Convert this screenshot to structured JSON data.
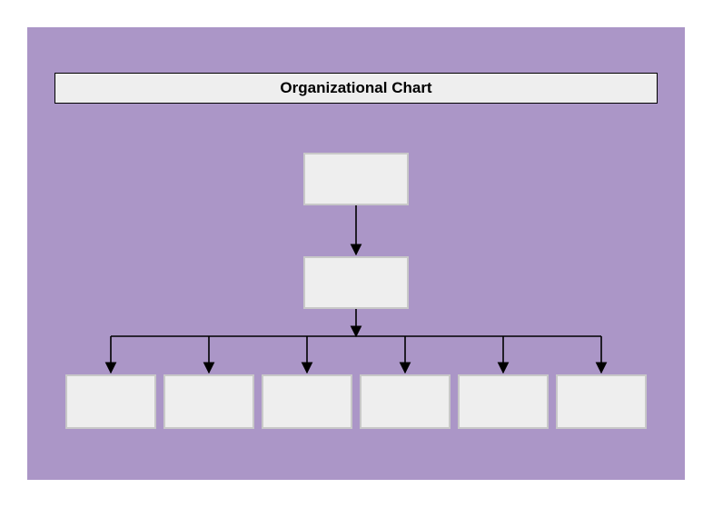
{
  "title": "Organizational Chart",
  "colors": {
    "canvas_bg": "#ab96c7",
    "node_fill": "#eeeeee",
    "node_border": "#c8c8c8",
    "title_fill": "#eeeeee",
    "title_border": "#000000",
    "connector": "#000000"
  },
  "nodes": {
    "root": {
      "label": ""
    },
    "mid": {
      "label": ""
    },
    "leaf1": {
      "label": ""
    },
    "leaf2": {
      "label": ""
    },
    "leaf3": {
      "label": ""
    },
    "leaf4": {
      "label": ""
    },
    "leaf5": {
      "label": ""
    },
    "leaf6": {
      "label": ""
    }
  },
  "chart_data": {
    "type": "org-chart",
    "title": "Organizational Chart",
    "root": {
      "id": "root",
      "label": "",
      "children": [
        {
          "id": "mid",
          "label": "",
          "children": [
            {
              "id": "leaf1",
              "label": ""
            },
            {
              "id": "leaf2",
              "label": ""
            },
            {
              "id": "leaf3",
              "label": ""
            },
            {
              "id": "leaf4",
              "label": ""
            },
            {
              "id": "leaf5",
              "label": ""
            },
            {
              "id": "leaf6",
              "label": ""
            }
          ]
        }
      ]
    }
  }
}
